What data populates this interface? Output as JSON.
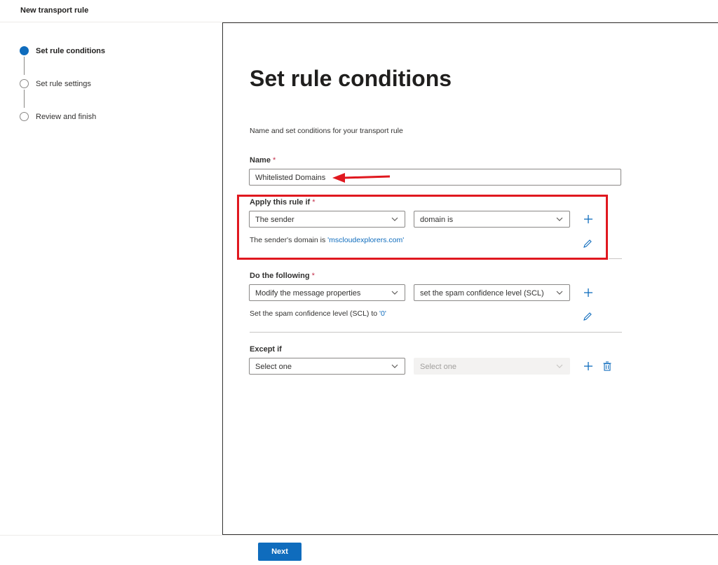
{
  "header": {
    "title": "New transport rule"
  },
  "steps": [
    {
      "label": "Set rule conditions",
      "active": true
    },
    {
      "label": "Set rule settings",
      "active": false
    },
    {
      "label": "Review and finish",
      "active": false
    }
  ],
  "page": {
    "heading": "Set rule conditions",
    "subtitle": "Name and set conditions for your transport rule"
  },
  "name_field": {
    "label": "Name",
    "required_mark": "*",
    "value": "Whitelisted Domains"
  },
  "apply_rule": {
    "label": "Apply this rule if",
    "required_mark": "*",
    "condition_select": "The sender",
    "predicate_select": "domain is",
    "description_prefix": "The sender's domain is ",
    "description_value": "'mscloudexplorers.com'"
  },
  "do_following": {
    "label": "Do the following",
    "required_mark": "*",
    "action_select": "Modify the message properties",
    "property_select": "set the spam confidence level (SCL)",
    "description_prefix": "Set the spam confidence level (SCL) to ",
    "description_value": "'0'"
  },
  "except_if": {
    "label": "Except if",
    "condition_select": "Select one",
    "predicate_select": "Select one"
  },
  "footer": {
    "next_label": "Next"
  },
  "colors": {
    "accent": "#0f6cbd",
    "annotation_red": "#e0181f",
    "required": "#c4314b"
  }
}
